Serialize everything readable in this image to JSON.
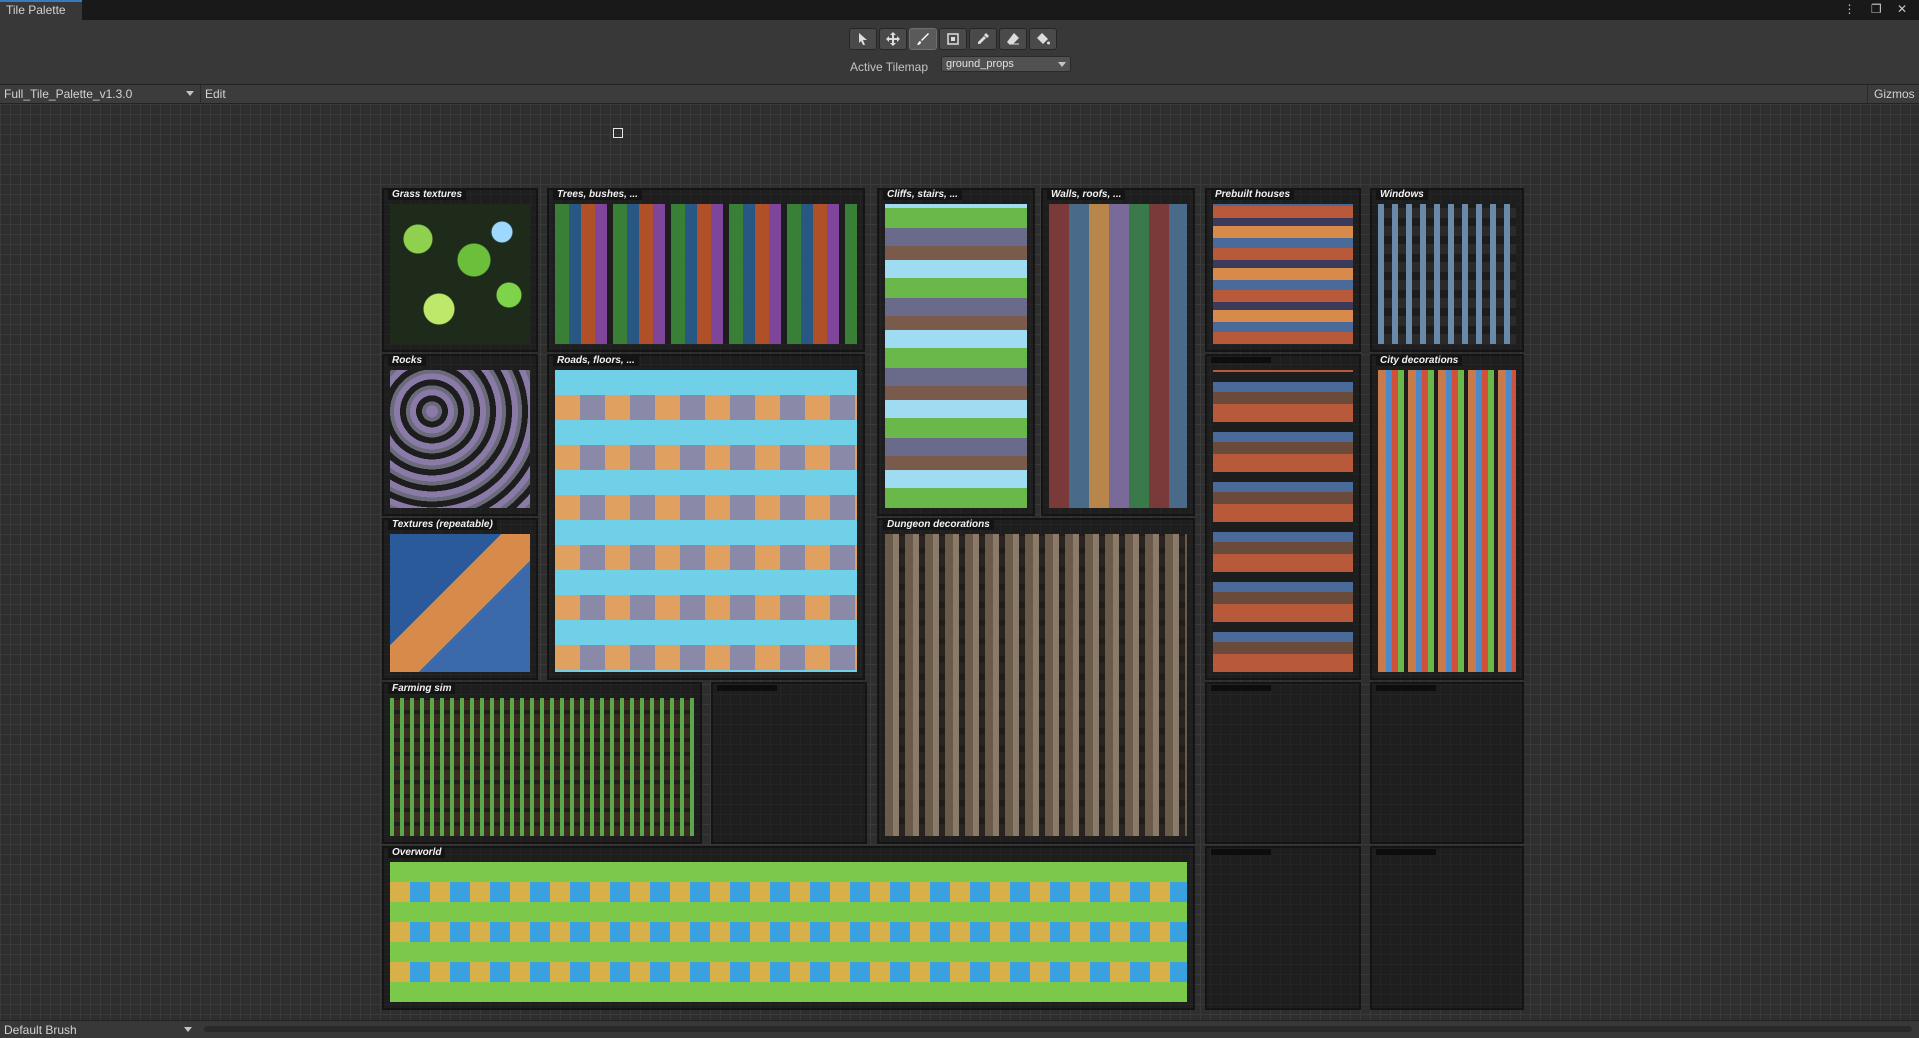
{
  "window": {
    "tab_title": "Tile Palette",
    "controls": "⋮ ❐ ✕"
  },
  "toolbar": {
    "tools": [
      "select-tool",
      "move-tool",
      "paint-tool",
      "box-fill-tool",
      "pick-tool",
      "erase-tool",
      "fill-tool"
    ],
    "active_tool": "paint-tool",
    "active_tilemap_label": "Active Tilemap",
    "active_tilemap_value": "ground_props"
  },
  "palette_bar": {
    "palette_name": "Full_Tile_Palette_v1.3.0",
    "edit_label": "Edit",
    "gizmos_label": "Gizmos"
  },
  "sections": [
    {
      "id": "grass",
      "label": "Grass textures"
    },
    {
      "id": "trees",
      "label": "Trees, bushes, ..."
    },
    {
      "id": "cliffs",
      "label": "Cliffs, stairs, ..."
    },
    {
      "id": "walls",
      "label": "Walls, roofs, ..."
    },
    {
      "id": "houses",
      "label": "Prebuilt houses"
    },
    {
      "id": "windows",
      "label": "Windows"
    },
    {
      "id": "rocks",
      "label": "Rocks"
    },
    {
      "id": "roads",
      "label": "Roads, floors, ..."
    },
    {
      "id": "city",
      "label": "City decorations"
    },
    {
      "id": "textures",
      "label": "Textures (repeatable)"
    },
    {
      "id": "dungeon",
      "label": "Dungeon decorations"
    },
    {
      "id": "farming",
      "label": "Farming sim"
    },
    {
      "id": "overworld",
      "label": "Overworld"
    }
  ],
  "bottom_bar": {
    "brush_name": "Default Brush"
  },
  "colors": {
    "accent": "#3a79bb",
    "background": "#282828",
    "grid": "#3a3a3a"
  }
}
